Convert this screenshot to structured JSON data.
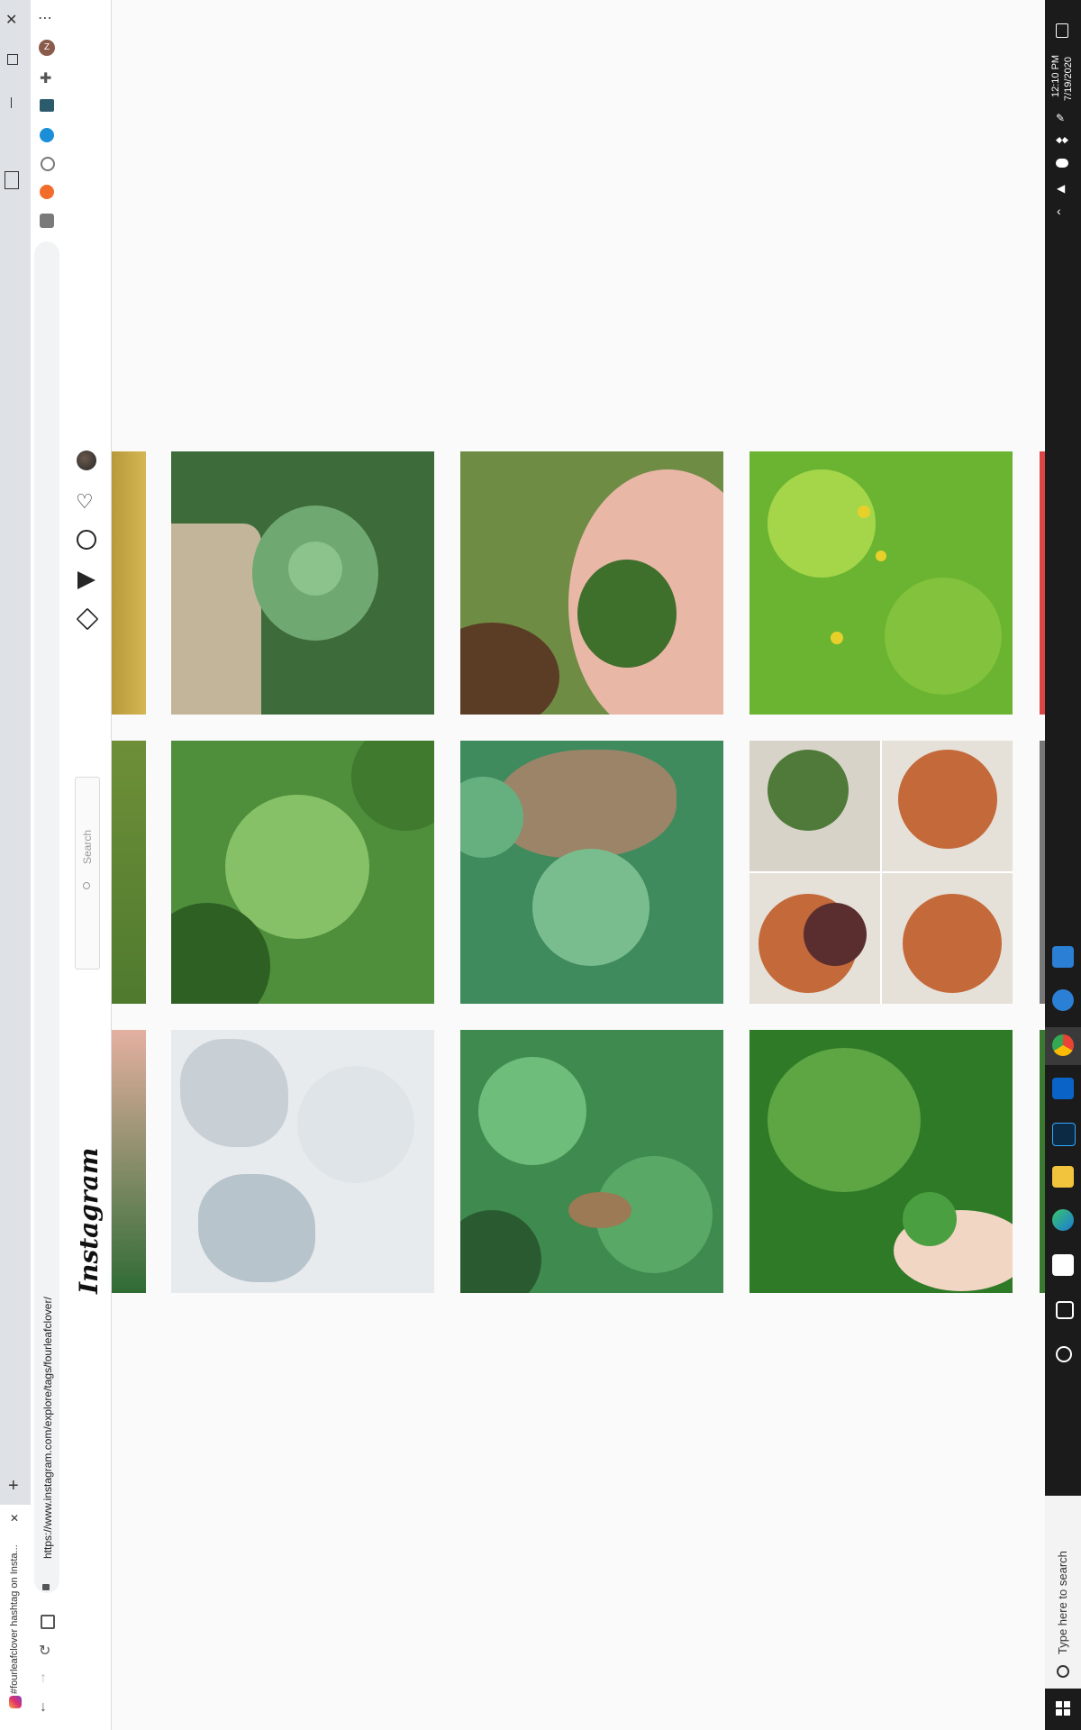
{
  "browser": {
    "tab_title": "#fourleafclover hashtag on Insta...",
    "url": "https://www.instagram.com/explore/tags/fourleafclover/",
    "profile_initial": "Z",
    "new_tab_symbol": "+",
    "close_symbol": "✕",
    "menu_symbol": "⋯"
  },
  "instagram": {
    "logo": "Instagram",
    "search_placeholder": "Search",
    "nav_icons": [
      "home-icon",
      "direct-icon",
      "explore-icon",
      "activity-icon",
      "profile-avatar"
    ]
  },
  "grid": {
    "rows": [
      {
        "tiles": [
          {
            "desc": "clover-on-grass",
            "palette": [
              "#3d6b3a",
              "#6fa871",
              "#c2b59a"
            ]
          },
          {
            "desc": "clover-on-hand",
            "palette": [
              "#6f8c45",
              "#e8b7a6",
              "#3e6f2b"
            ]
          },
          {
            "desc": "oxalis-yellow-flowers",
            "palette": [
              "#6ab432",
              "#a5d64a",
              "#e8d02a"
            ]
          }
        ]
      },
      {
        "tiles": [
          {
            "desc": "clover-in-grass",
            "palette": [
              "#4f8f3c",
              "#86c167",
              "#2e5f23"
            ]
          },
          {
            "desc": "clover-with-dry-leaf",
            "palette": [
              "#3f8b5e",
              "#79bd8e",
              "#9c8468"
            ]
          },
          {
            "desc": "four-leaf-clover-pots",
            "palette": [
              "#c46a3a",
              "#4f7a3a",
              "#e5e0d8"
            ]
          }
        ]
      },
      {
        "tiles": [
          {
            "desc": "shot-glasses",
            "palette": [
              "#e8ebee",
              "#c8d0d6",
              "#b7c4cc"
            ]
          },
          {
            "desc": "clover-patch",
            "palette": [
              "#3f8a4f",
              "#6fbd7a",
              "#2a5b30"
            ]
          },
          {
            "desc": "clover-lawn-hand",
            "palette": [
              "#2f7a27",
              "#5ea544",
              "#f1d6c4"
            ]
          }
        ]
      }
    ]
  },
  "taskbar": {
    "time": "12:10 PM",
    "date": "7/19/2020",
    "search_placeholder": "Type here to search"
  },
  "colors": {
    "ig_border": "#dbdbdb",
    "taskbar_bg": "#1b1b1b",
    "tab_bg": "#dee1e6"
  }
}
